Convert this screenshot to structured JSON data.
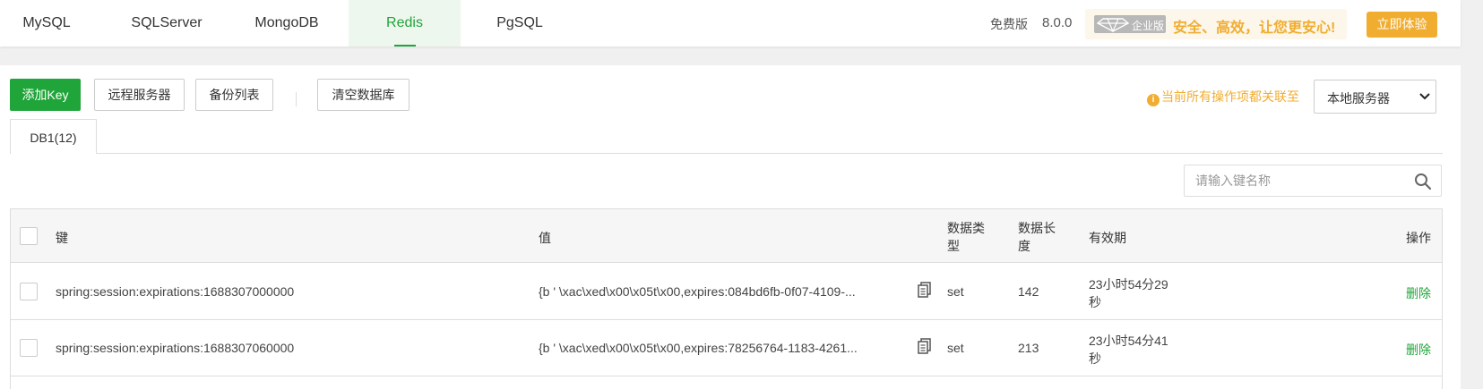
{
  "nav": {
    "tabs": [
      {
        "label": "MySQL"
      },
      {
        "label": "SQLServer"
      },
      {
        "label": "MongoDB"
      },
      {
        "label": "Redis"
      },
      {
        "label": "PgSQL"
      }
    ],
    "active_tab": "Redis",
    "edition": "免费版",
    "version": "8.0.0",
    "promo": {
      "badge": "企业版",
      "slogan": "安全、高效，让您更安心!",
      "try_label": "立即体验"
    }
  },
  "toolbar": {
    "add_key": "添加Key",
    "remote_server": "远程服务器",
    "backup_list": "备份列表",
    "clear_db": "清空数据库",
    "notice": "当前所有操作项都关联至",
    "server_select": "本地服务器"
  },
  "db_tab": "DB1(12)",
  "search": {
    "placeholder": "请输入键名称"
  },
  "table": {
    "headers": {
      "key": "键",
      "value": "值",
      "type_line1": "数据类",
      "type_line2": "型",
      "length_line1": "数据长",
      "length_line2": "度",
      "ttl": "有效期",
      "action": "操作"
    },
    "rows": [
      {
        "key": "spring:session:expirations:1688307000000",
        "value": "{b ' \\xac\\xed\\x00\\x05t\\x00,expires:084bd6fb-0f07-4109-...",
        "type": "set",
        "length": "142",
        "ttl_line1": "23小时54分29",
        "ttl_line2": "秒",
        "action": "删除"
      },
      {
        "key": "spring:session:expirations:1688307060000",
        "value": "{b ' \\xac\\xed\\x00\\x05t\\x00,expires:78256764-1183-4261...",
        "type": "set",
        "length": "213",
        "ttl_line1": "23小时54分41",
        "ttl_line2": "秒",
        "action": "删除"
      }
    ]
  },
  "colors": {
    "accent": "#20a53a",
    "promo": "#f0ad30"
  }
}
